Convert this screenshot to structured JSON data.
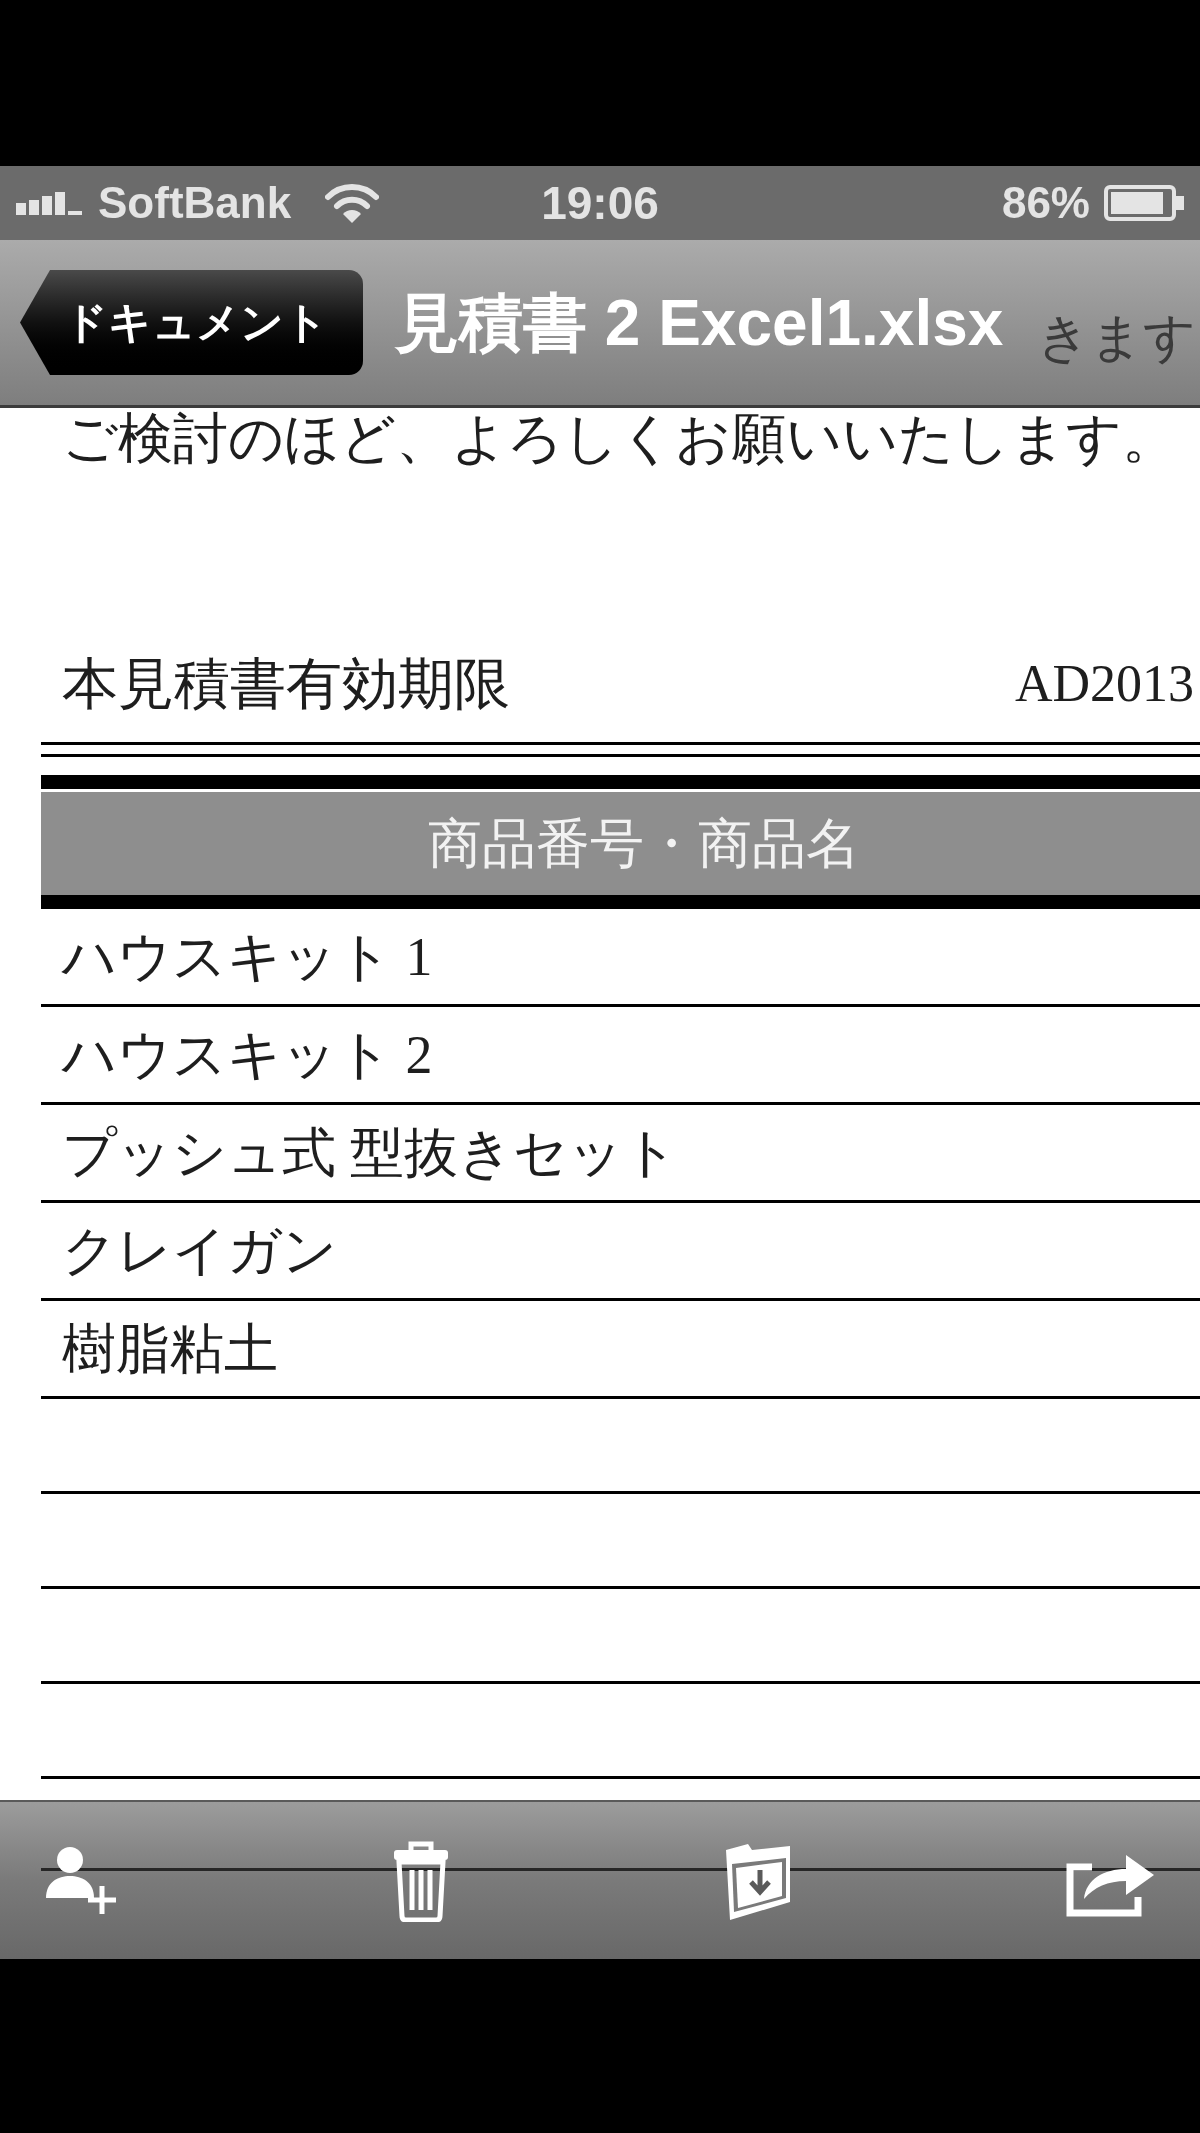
{
  "status_bar": {
    "carrier": "SoftBank",
    "time": "19:06",
    "battery": "86%"
  },
  "nav_bar": {
    "back_button": "ドキュメント",
    "title": "見積書 2 Excel1.xlsx",
    "text_behind": "きます"
  },
  "document": {
    "intro_line": "ご検討のほど、よろしくお願いいたします。",
    "validity_label": "本見積書有効期限",
    "validity_value": "AD2013",
    "table": {
      "header": "商品番号・商品名",
      "rows": [
        "ハウスキット 1",
        "ハウスキット 2",
        "プッシュ式 型抜きセット",
        "クレイガン",
        "樹脂粘土"
      ]
    }
  }
}
